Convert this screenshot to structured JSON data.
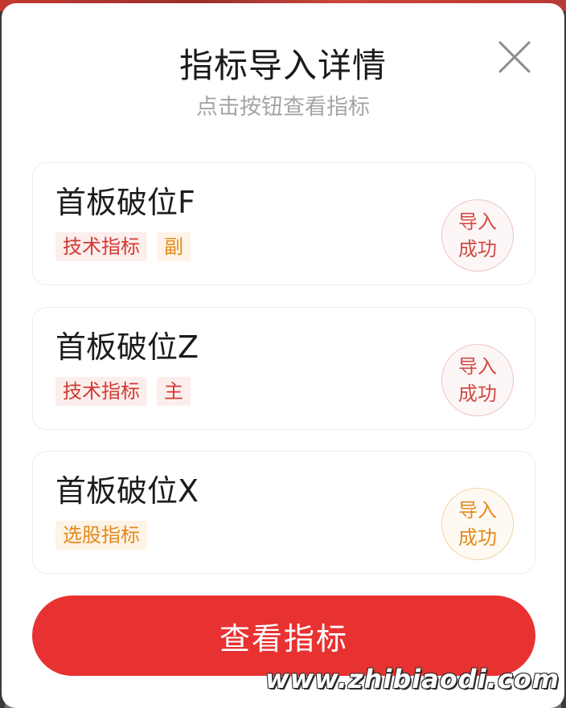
{
  "dialog": {
    "title": "指标导入详情",
    "subtitle": "点击按钮查看指标"
  },
  "items": [
    {
      "name": "首板破位F",
      "tags": [
        {
          "label": "技术指标",
          "color": "red"
        },
        {
          "label": "副",
          "color": "orange"
        }
      ],
      "status": {
        "line1": "导入",
        "line2": "成功",
        "color": "red"
      }
    },
    {
      "name": "首板破位Z",
      "tags": [
        {
          "label": "技术指标",
          "color": "red"
        },
        {
          "label": "主",
          "color": "red"
        }
      ],
      "status": {
        "line1": "导入",
        "line2": "成功",
        "color": "red"
      }
    },
    {
      "name": "首板破位X",
      "tags": [
        {
          "label": "选股指标",
          "color": "orange"
        }
      ],
      "status": {
        "line1": "导入",
        "line2": "成功",
        "color": "orange"
      }
    }
  ],
  "button": {
    "label": "查看指标"
  },
  "watermark": "www.zhibiaodi.com",
  "colors": {
    "primary_red": "#e83232",
    "tag_red": "#d33b34",
    "tag_orange": "#e38a1b"
  }
}
